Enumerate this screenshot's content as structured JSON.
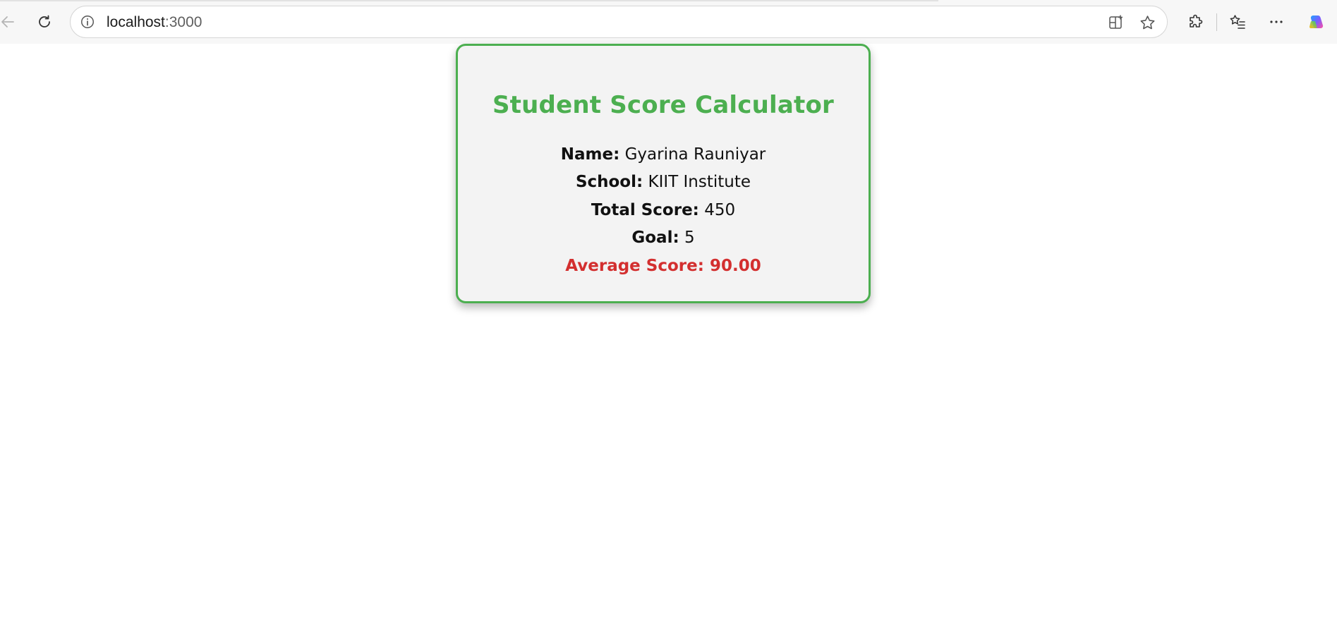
{
  "browser": {
    "url_host": "localhost",
    "url_port": ":3000",
    "icons": {
      "back": "back-arrow-icon",
      "refresh": "refresh-icon",
      "site_info": "info-icon",
      "split_screen": "split-screen-icon",
      "favorite": "star-icon",
      "extensions": "puzzle-icon",
      "favorites_list": "favorites-list-icon",
      "more": "more-dots-icon",
      "copilot": "copilot-icon"
    }
  },
  "card": {
    "title": "Student Score Calculator",
    "name_label": "Name:",
    "name_value": "Gyarina Rauniyar",
    "school_label": "School:",
    "school_value": "KIIT Institute",
    "total_label": "Total Score:",
    "total_value": "450",
    "goal_label": "Goal:",
    "goal_value": "5",
    "average_label": "Average Score:",
    "average_value": "90.00"
  },
  "colors": {
    "accent_green": "#4caf50",
    "average_red": "#d32f2f",
    "card_background": "#f3f3f3"
  }
}
